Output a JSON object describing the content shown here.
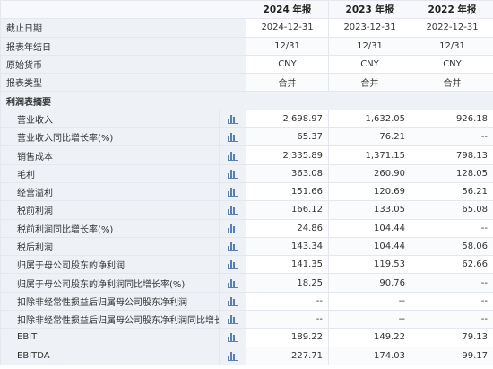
{
  "header": {
    "columns": [
      "2024 年报",
      "2023 年报",
      "2022 年报"
    ]
  },
  "meta_rows": [
    {
      "label": "截止日期",
      "values": [
        "2024-12-31",
        "2023-12-31",
        "2022-12-31"
      ]
    },
    {
      "label": "报表年结日",
      "values": [
        "12/31",
        "12/31",
        "12/31"
      ]
    },
    {
      "label": "原始货币",
      "values": [
        "CNY",
        "CNY",
        "CNY"
      ]
    },
    {
      "label": "报表类型",
      "values": [
        "合并",
        "合并",
        "合并"
      ]
    }
  ],
  "section_title": "利润表摘要",
  "chart_icon": "bar-chart-icon",
  "data_rows": [
    {
      "label": "营业收入",
      "values": [
        "2,698.97",
        "1,632.05",
        "926.18"
      ]
    },
    {
      "label": "营业收入同比增长率(%)",
      "values": [
        "65.37",
        "76.21",
        "--"
      ]
    },
    {
      "label": "销售成本",
      "values": [
        "2,335.89",
        "1,371.15",
        "798.13"
      ]
    },
    {
      "label": "毛利",
      "values": [
        "363.08",
        "260.90",
        "128.05"
      ]
    },
    {
      "label": "经营溢利",
      "values": [
        "151.66",
        "120.69",
        "56.21"
      ]
    },
    {
      "label": "税前利润",
      "values": [
        "166.12",
        "133.05",
        "65.08"
      ]
    },
    {
      "label": "税前利润同比增长率(%)",
      "values": [
        "24.86",
        "104.44",
        "--"
      ]
    },
    {
      "label": "税后利润",
      "values": [
        "143.34",
        "104.44",
        "58.06"
      ]
    },
    {
      "label": "归属于母公司股东的净利润",
      "values": [
        "141.35",
        "119.53",
        "62.66"
      ]
    },
    {
      "label": "归属于母公司股东的净利润同比增长率(%)",
      "values": [
        "18.25",
        "90.76",
        "--"
      ]
    },
    {
      "label": "扣除非经常性损益后归属母公司股东净利润",
      "values": [
        "--",
        "--",
        "--"
      ]
    },
    {
      "label": "扣除非经常性损益后归属母公司股东净利润同比增长...",
      "values": [
        "--",
        "--",
        "--"
      ]
    },
    {
      "label": "EBIT",
      "values": [
        "189.22",
        "149.22",
        "79.13"
      ]
    },
    {
      "label": "EBITDA",
      "values": [
        "227.71",
        "174.03",
        "99.17"
      ]
    }
  ]
}
